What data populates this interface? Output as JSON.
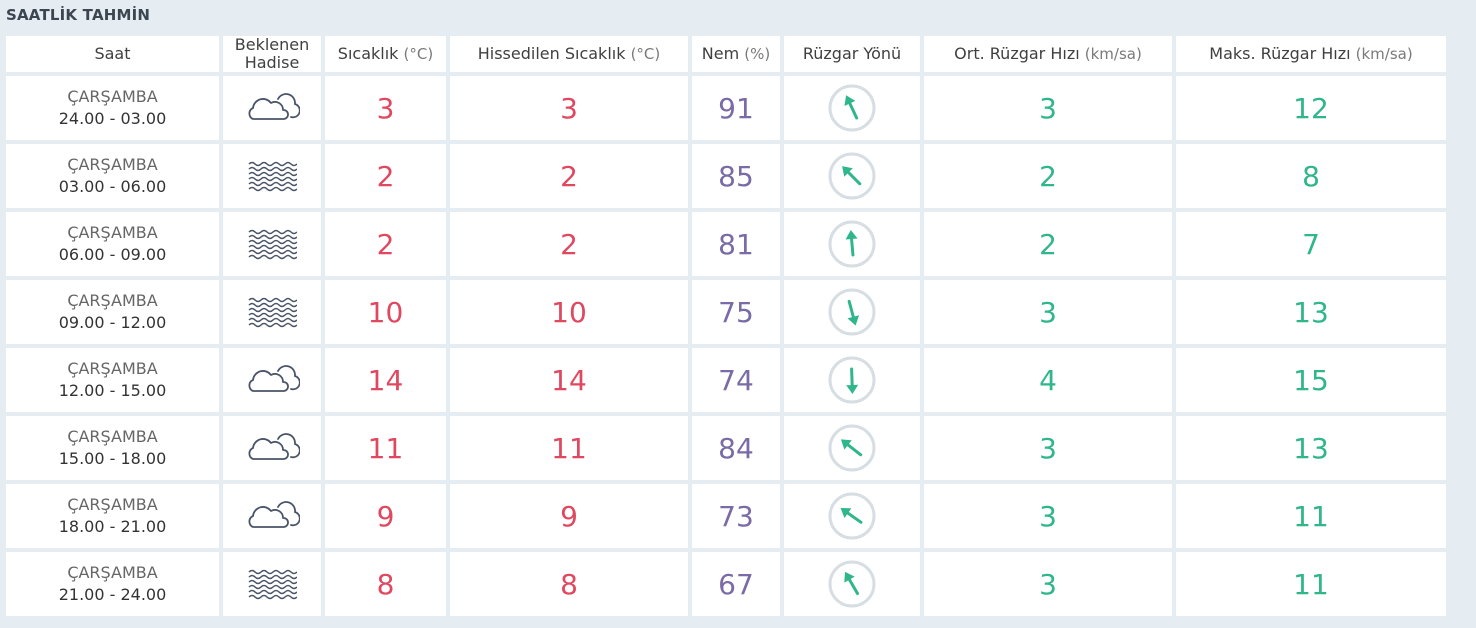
{
  "section_title": "SAATLİK TAHMİN",
  "headers": {
    "saat": "Saat",
    "hadise_line1": "Beklenen",
    "hadise_line2": "Hadise",
    "sicaklik": "Sıcaklık",
    "sicaklik_unit": "(°C)",
    "hissedilen": "Hissedilen Sıcaklık",
    "hissedilen_unit": "(°C)",
    "nem": "Nem",
    "nem_unit": "(%)",
    "ruzgar_yonu": "Rüzgar Yönü",
    "ort_ruzgar": "Ort. Rüzgar Hızı",
    "ort_ruzgar_unit": "(km/sa)",
    "maks_ruzgar": "Maks. Rüzgar Hızı",
    "maks_ruzgar_unit": "(km/sa)"
  },
  "colors": {
    "temperature": "#e0485f",
    "humidity": "#7a6aa6",
    "wind": "#2fb68a",
    "icon_stroke": "#4a5468"
  },
  "rows": [
    {
      "day": "ÇARŞAMBA",
      "range": "24.00 - 03.00",
      "icon": "cloud-icon",
      "temp": "3",
      "feels": "3",
      "humidity": "91",
      "wind_direction_deg": 335,
      "wind_avg": "3",
      "wind_max": "12"
    },
    {
      "day": "ÇARŞAMBA",
      "range": "03.00 - 06.00",
      "icon": "fog-icon",
      "temp": "2",
      "feels": "2",
      "humidity": "85",
      "wind_direction_deg": 315,
      "wind_avg": "2",
      "wind_max": "8"
    },
    {
      "day": "ÇARŞAMBA",
      "range": "06.00 - 09.00",
      "icon": "fog-icon",
      "temp": "2",
      "feels": "2",
      "humidity": "81",
      "wind_direction_deg": 355,
      "wind_avg": "2",
      "wind_max": "7"
    },
    {
      "day": "ÇARŞAMBA",
      "range": "09.00 - 12.00",
      "icon": "fog-icon",
      "temp": "10",
      "feels": "10",
      "humidity": "75",
      "wind_direction_deg": 165,
      "wind_avg": "3",
      "wind_max": "13"
    },
    {
      "day": "ÇARŞAMBA",
      "range": "12.00 - 15.00",
      "icon": "cloud-icon",
      "temp": "14",
      "feels": "14",
      "humidity": "74",
      "wind_direction_deg": 178,
      "wind_avg": "4",
      "wind_max": "15"
    },
    {
      "day": "ÇARŞAMBA",
      "range": "15.00 - 18.00",
      "icon": "cloud-icon",
      "temp": "11",
      "feels": "11",
      "humidity": "84",
      "wind_direction_deg": 308,
      "wind_avg": "3",
      "wind_max": "13"
    },
    {
      "day": "ÇARŞAMBA",
      "range": "18.00 - 21.00",
      "icon": "cloud-icon",
      "temp": "9",
      "feels": "9",
      "humidity": "73",
      "wind_direction_deg": 305,
      "wind_avg": "3",
      "wind_max": "11"
    },
    {
      "day": "ÇARŞAMBA",
      "range": "21.00 - 24.00",
      "icon": "fog-icon",
      "temp": "8",
      "feels": "8",
      "humidity": "67",
      "wind_direction_deg": 330,
      "wind_avg": "3",
      "wind_max": "11"
    }
  ]
}
